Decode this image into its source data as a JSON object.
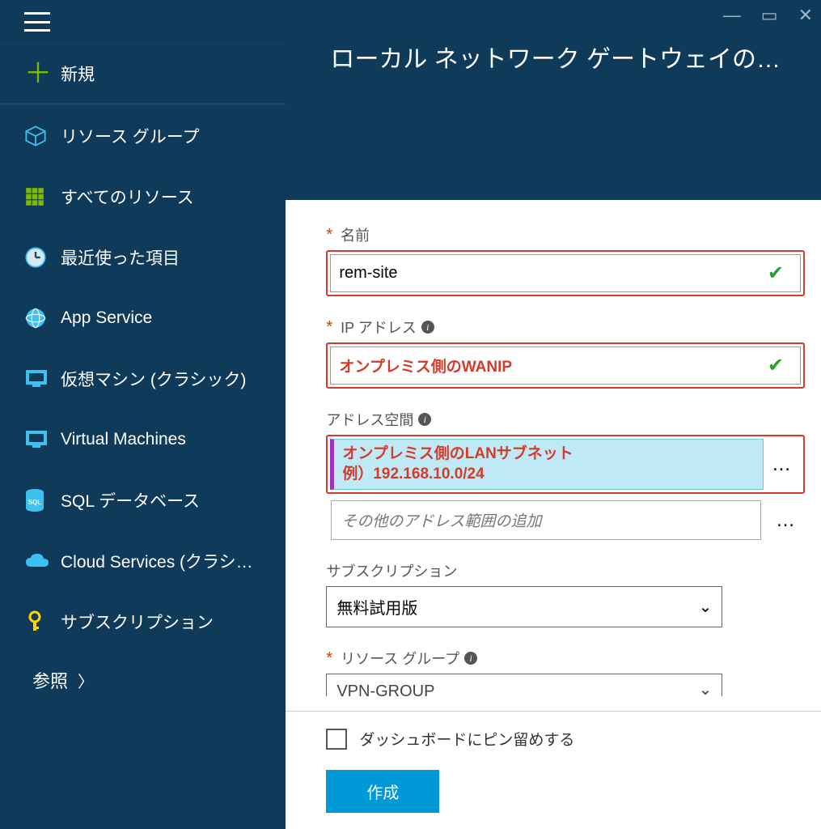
{
  "sidebar": {
    "new_label": "新規",
    "items": [
      {
        "label": "リソース グループ"
      },
      {
        "label": "すべてのリソース"
      },
      {
        "label": "最近使った項目"
      },
      {
        "label": "App Service"
      },
      {
        "label": "仮想マシン (クラシック)"
      },
      {
        "label": "Virtual Machines"
      },
      {
        "label": "SQL データベース"
      },
      {
        "label": "Cloud Services (クラシ…"
      },
      {
        "label": "サブスクリプション"
      }
    ],
    "browse_label": "参照"
  },
  "panel": {
    "title": "ローカル ネットワーク ゲートウェイの…"
  },
  "form": {
    "name_label": "名前",
    "name_value": "rem-site",
    "ip_label": "IP アドレス",
    "ip_value": "オンプレミス側のWANIP",
    "addr_space_label": "アドレス空間",
    "addr_line1": "オンプレミス側のLANサブネット",
    "addr_line2": "例）192.168.10.0/24",
    "addr_placeholder": "その他のアドレス範囲の追加",
    "subscription_label": "サブスクリプション",
    "subscription_value": "無料試用版",
    "rg_label": "リソース グループ",
    "rg_value": "VPN-GROUP"
  },
  "footer": {
    "pin_label": "ダッシュボードにピン留めする",
    "create_label": "作成"
  }
}
